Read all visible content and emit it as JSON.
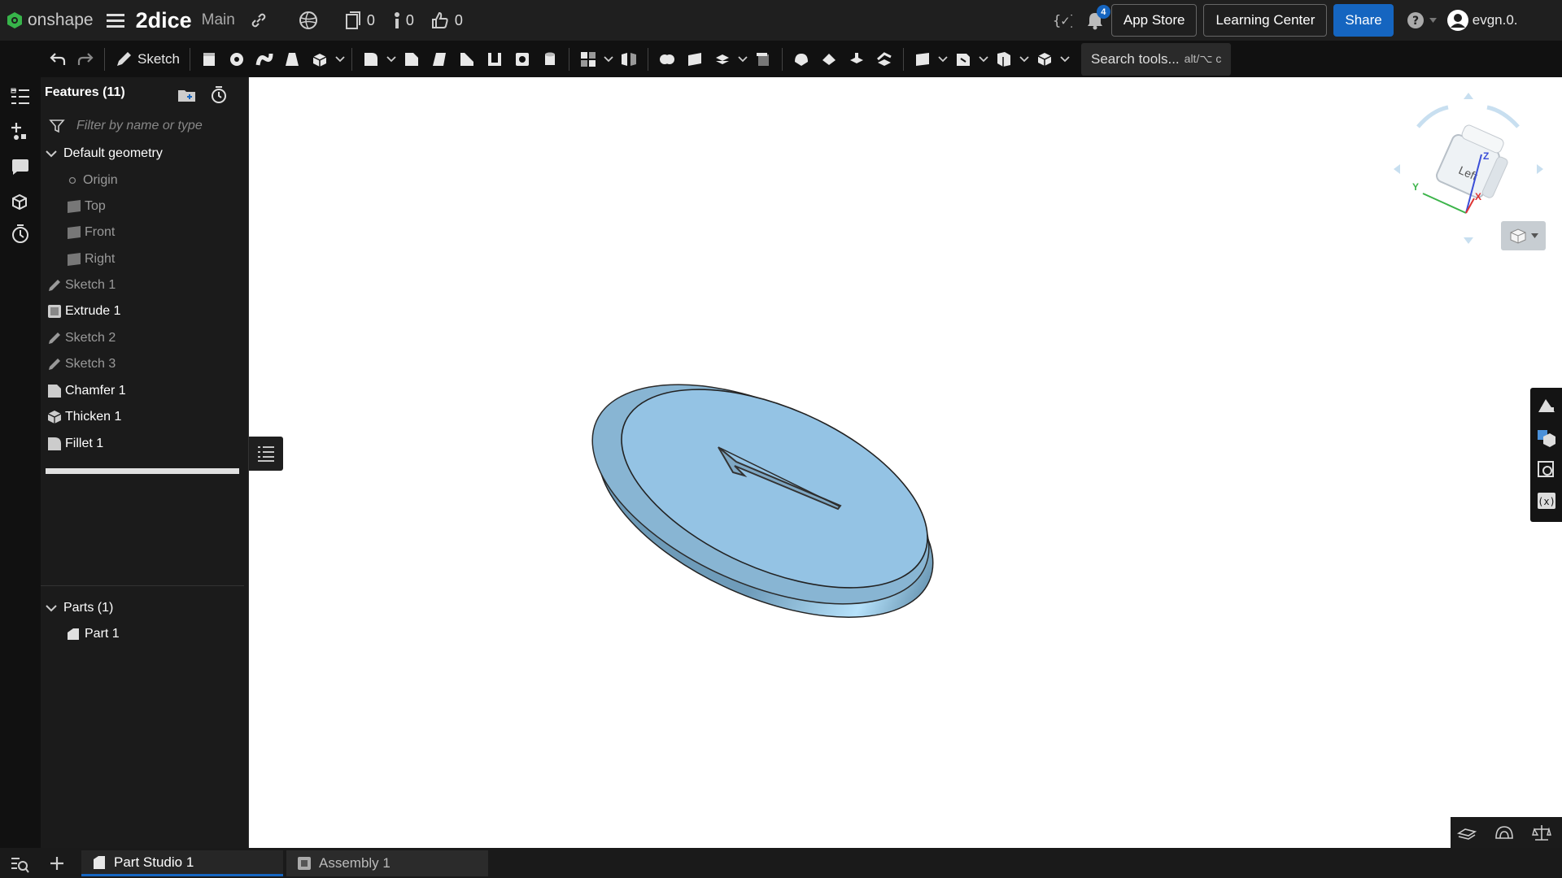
{
  "app": {
    "logo_text": "onshape",
    "doc_name": "2dice",
    "branch": "Main"
  },
  "header": {
    "versions_count": "0",
    "info_count": "0",
    "likes_count": "0",
    "notification_badge": "4",
    "app_store": "App Store",
    "learning_center": "Learning Center",
    "share": "Share",
    "user": "evgn.0."
  },
  "toolbar": {
    "sketch_label": "Sketch",
    "search_placeholder": "Search tools...",
    "search_shortcut": "alt/⌥ c"
  },
  "features": {
    "title": "Features (11)",
    "filter_placeholder": "Filter by name or type",
    "default_geometry": "Default geometry",
    "items": [
      {
        "label": "Origin"
      },
      {
        "label": "Top"
      },
      {
        "label": "Front"
      },
      {
        "label": "Right"
      },
      {
        "label": "Sketch 1"
      },
      {
        "label": "Extrude 1"
      },
      {
        "label": "Sketch 2"
      },
      {
        "label": "Sketch 3"
      },
      {
        "label": "Chamfer 1"
      },
      {
        "label": "Thicken 1"
      },
      {
        "label": "Fillet 1"
      }
    ]
  },
  "parts": {
    "title": "Parts (1)",
    "items": [
      {
        "label": "Part 1"
      }
    ]
  },
  "viewcube": {
    "face": "Left",
    "axis_x": "X",
    "axis_y": "Y",
    "axis_z": "Z"
  },
  "tabs": [
    {
      "label": "Part Studio 1"
    },
    {
      "label": "Assembly 1"
    }
  ],
  "colors": {
    "accent": "#1565c0",
    "part": "#90c3e6",
    "logo": "#37b44a"
  }
}
